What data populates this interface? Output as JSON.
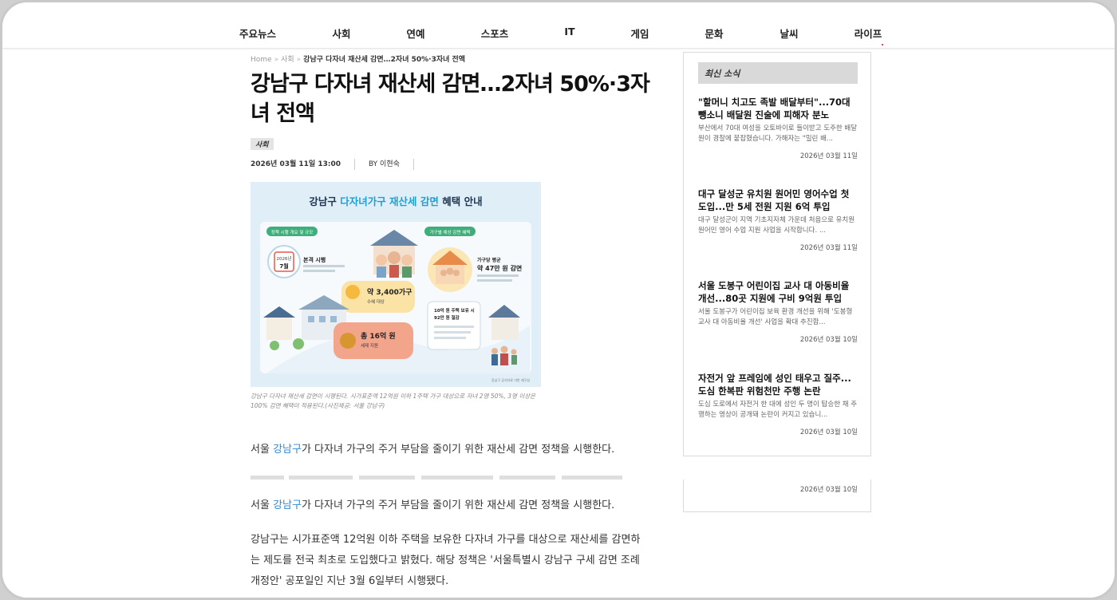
{
  "nav": {
    "items": [
      "주요뉴스",
      "사회",
      "연예",
      "스포츠",
      "IT",
      "게임",
      "문화",
      "날씨",
      "라이프"
    ]
  },
  "breadcrumb": {
    "home": "Home",
    "section": "사회",
    "current": "강남구 다자녀 재산세 감면…2자녀 50%·3자녀 전액"
  },
  "article": {
    "title": "강남구 다자녀 재산세 감면…2자녀 50%·3자녀 전액",
    "category": "사회",
    "date": "2026년 03월 11일 13:00",
    "author": "BY 이현숙",
    "figure": {
      "title_pre": "강남구 ",
      "title_hl": "다자녀가구 재산세 감면",
      "title_post": " 혜택 안내",
      "label1": "정책 시행 개요 및 규모",
      "label2": "가구별 예상 감면 혜택",
      "cal_year": "2026년",
      "cal_month": "7월",
      "start": "본격 시행",
      "households": "약 3,400가구",
      "households_sub": "수혜 대상",
      "avg_label": "가구당 평균",
      "avg_amount": "약 47만 원 감면",
      "total": "총 16억 원",
      "total_sub": "세제 지원",
      "case_title": "10억 원 주택 보유 시",
      "case_amount": "92만 원 절감",
      "source": "강남구 공식자료 기반 재구성"
    },
    "caption": "강남구 다자녀 재산세 감면이 시행된다. 시가표준액 12억원 이하 1주택 가구 대상으로 자녀 2명 50%, 3명 이상은 100% 감면 혜택이 적용된다.(사진제공: 서울 강남구)",
    "lead": {
      "pre": "서울 ",
      "link": "강남구",
      "post": "가 다자녀 가구의 주거 부담을 줄이기 위한 재산세 감면 정책을 시행한다."
    },
    "body": "강남구는 시가표준액 12억원 이하 주택을 보유한 다자녀 가구를 대상으로 재산세를 감면하는 제도를 전국 최초로 도입했다고 밝혔다. 해당 정책은 '서울특별시 강남구 구세 감면 조례 개정안' 공포일인 지난 3월 6일부터 시행됐다."
  },
  "sidebar": {
    "title": "최신 소식",
    "news": [
      {
        "headline": "\"할머니 치고도 족발 배달부터\"...70대 뺑소니 배달원 진술에 피해자 분노",
        "summary": "부산에서 70대 여성을 오토바이로 들이받고 도주한 배달원이 경찰에 붙잡혔습니다. 가해자는 \"밀린 배...",
        "date": "2026년 03월 11일"
      },
      {
        "headline": "대구 달성군 유치원 원어민 영어수업 첫 도입...만 5세 전원 지원 6억 투입",
        "summary": "대구 달성군이 지역 기초지자체 가운데 처음으로 유치원 원어민 영어 수업 지원 사업을 시작합니다. ...",
        "date": "2026년 03월 11일"
      },
      {
        "headline": "서울 도봉구 어린이집 교사 대 아동비율 개선...80곳 지원에 구비 9억원 투입",
        "summary": "서울 도봉구가 어린이집 보육 환경 개선을 위해 '도봉형 교사 대 아동비율 개선' 사업을 확대 추진합...",
        "date": "2026년 03월 10일"
      },
      {
        "headline": "자전거 앞 프레임에 성인 태우고 질주... 도심 한복판 위험천만 주행 논란",
        "summary": "도심 도로에서 자전거 한 대에 성인 두 명이 탑승한 채 주행하는 영상이 공개돼 논란이 커지고 있습니...",
        "date": "2026년 03월 10일"
      }
    ],
    "extra_date": "2026년 03월 10일"
  }
}
